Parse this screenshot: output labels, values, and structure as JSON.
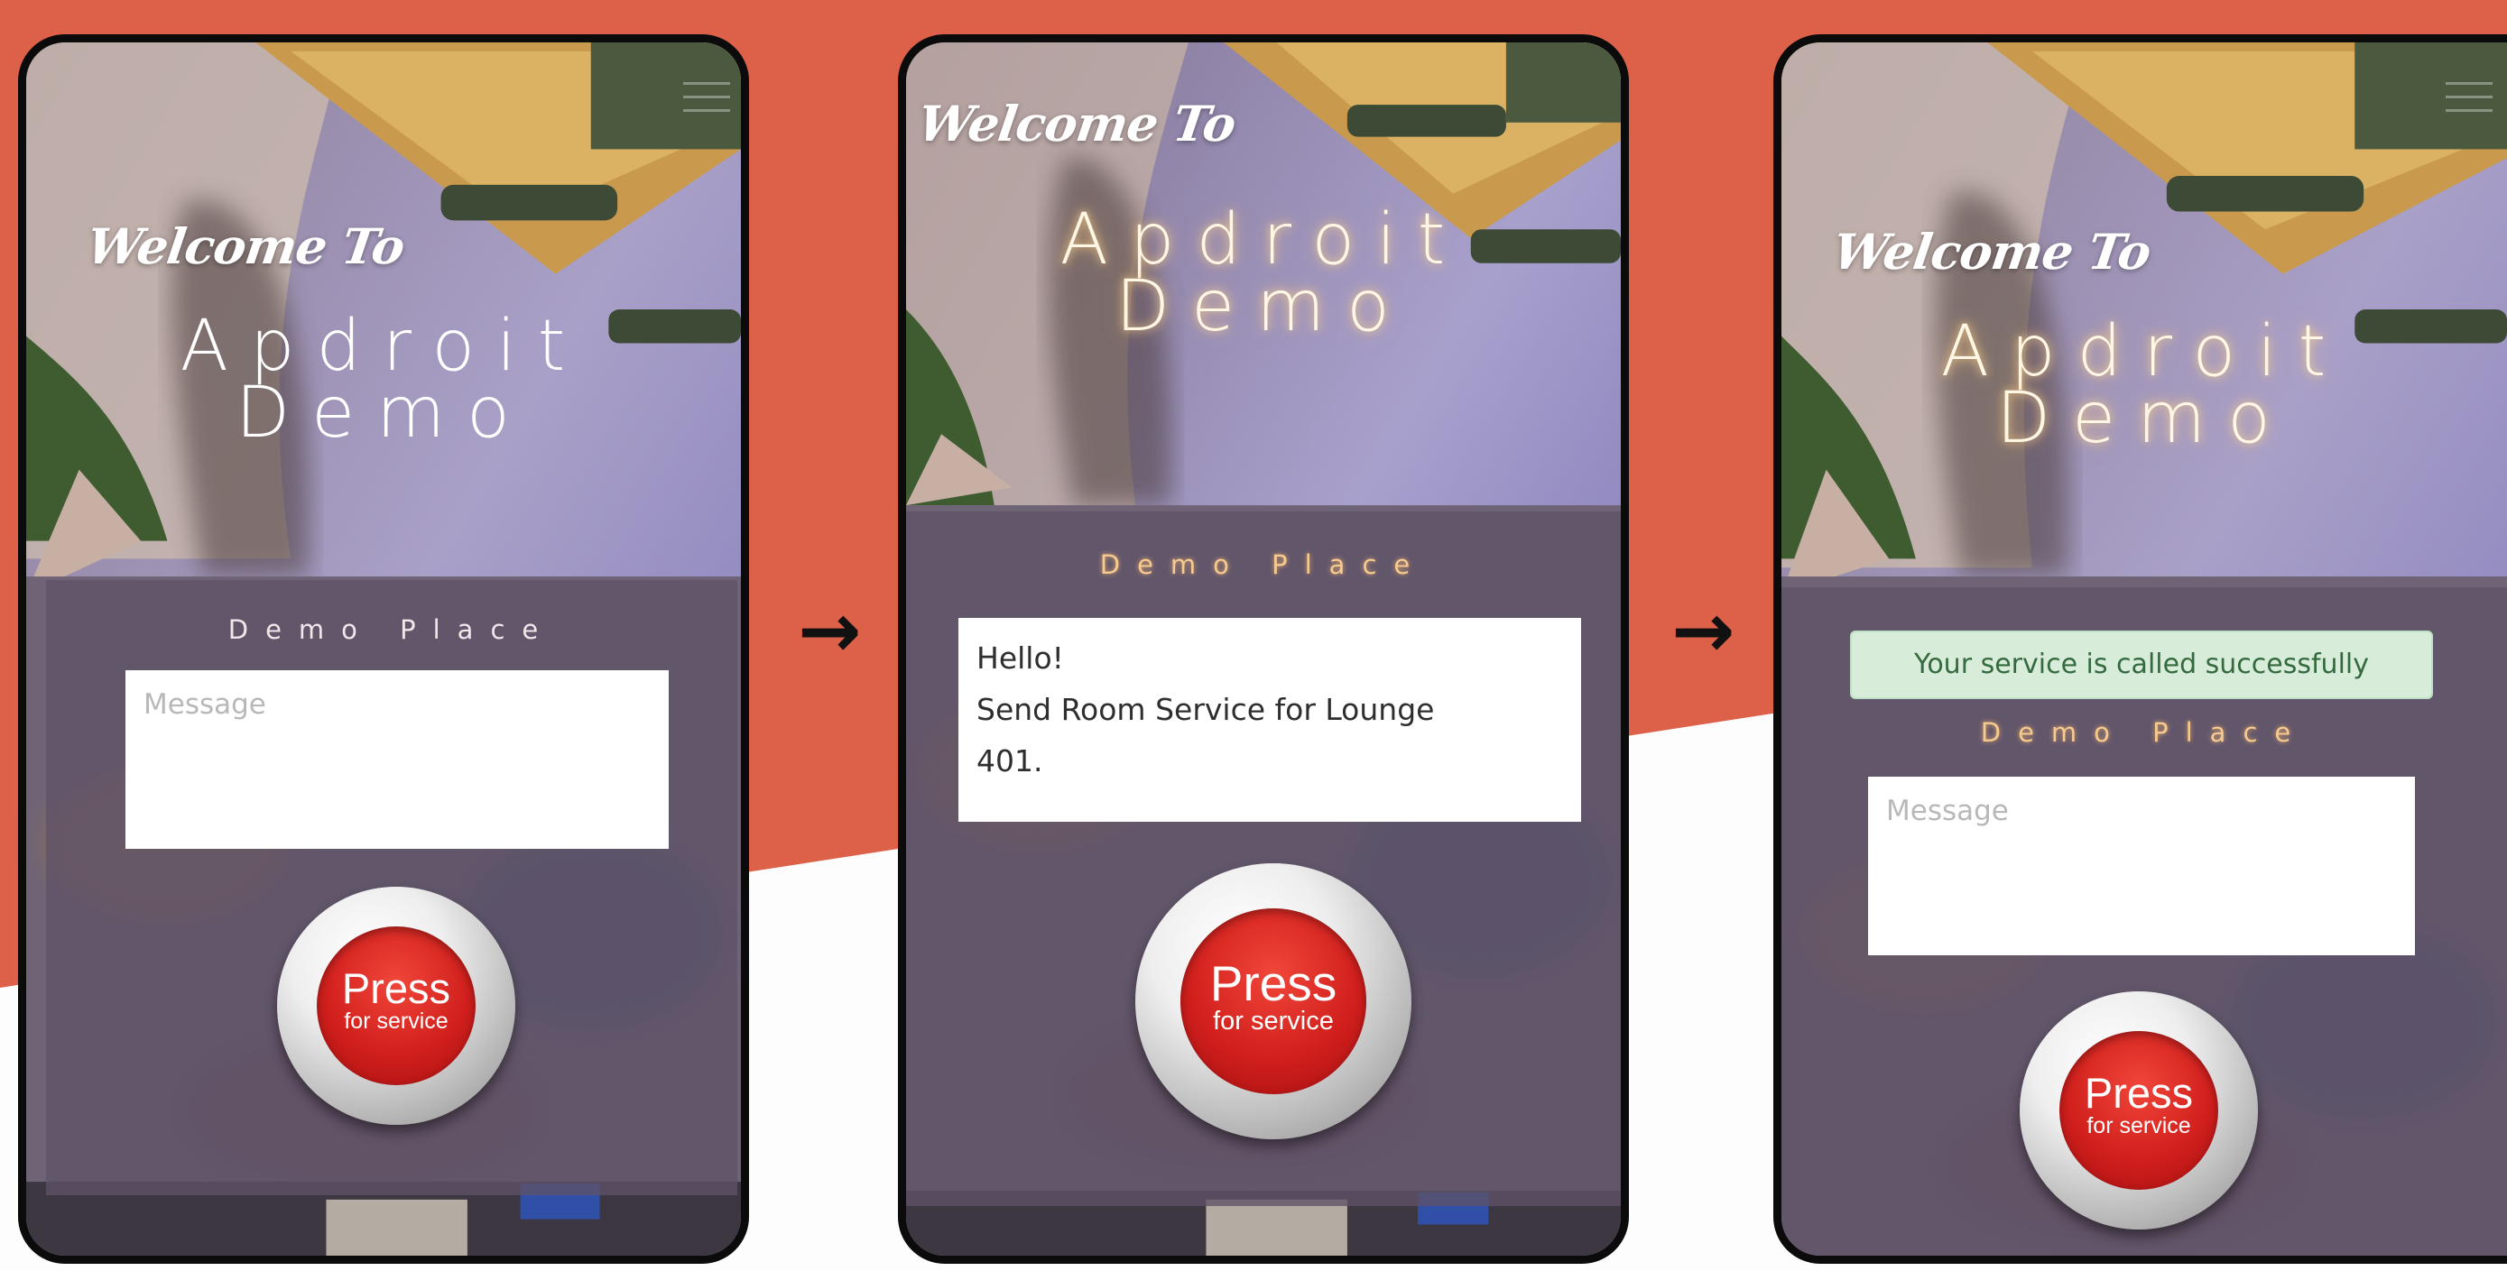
{
  "colors": {
    "accent_wave": "#dd6049",
    "phone_frame": "#0b0b0b",
    "button_red": "#d2201d",
    "success_bg": "#d7ecd9",
    "success_text": "#356a3f"
  },
  "screens": [
    {
      "welcome": "Welcome To",
      "brand_line1": "Apdroit",
      "brand_line2": "Demo",
      "place": "Demo Place",
      "message_placeholder": "Message",
      "press_label": "Press",
      "press_sublabel": "for service"
    },
    {
      "welcome": "Welcome To",
      "brand_line1": "Apdroit",
      "brand_line2": "Demo",
      "place": "Demo Place",
      "message_line1": "Hello!",
      "message_line2": "Send Room Service for Lounge",
      "message_line3": "401.",
      "press_label": "Press",
      "press_sublabel": "for service"
    },
    {
      "welcome": "Welcome To",
      "brand_line1": "Apdroit",
      "brand_line2": "Demo",
      "success_message": "Your service is called successfully",
      "place": "Demo Place",
      "message_placeholder": "Message",
      "press_label": "Press",
      "press_sublabel": "for service"
    }
  ],
  "arrows": [
    "→",
    "→"
  ]
}
